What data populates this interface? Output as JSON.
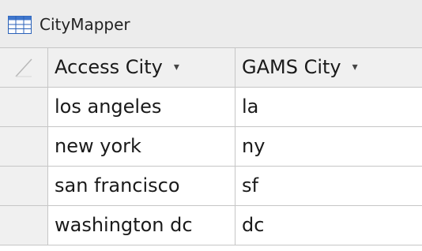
{
  "window": {
    "tab_title": "CityMapper",
    "tab_icon": "table-icon"
  },
  "grid": {
    "columns": [
      {
        "label": "Access City",
        "menu_icon": "dropdown-arrow-icon"
      },
      {
        "label": "GAMS City",
        "menu_icon": "dropdown-arrow-icon"
      }
    ],
    "rows": [
      {
        "access_city": "los angeles",
        "gams_city": "la"
      },
      {
        "access_city": "new york",
        "gams_city": "ny"
      },
      {
        "access_city": "san francisco",
        "gams_city": "sf"
      },
      {
        "access_city": "washington dc",
        "gams_city": "dc"
      }
    ]
  },
  "colors": {
    "header_bg": "#f0f0f0",
    "gridline": "#c6c6c6",
    "icon_blue": "#2b62b8"
  }
}
